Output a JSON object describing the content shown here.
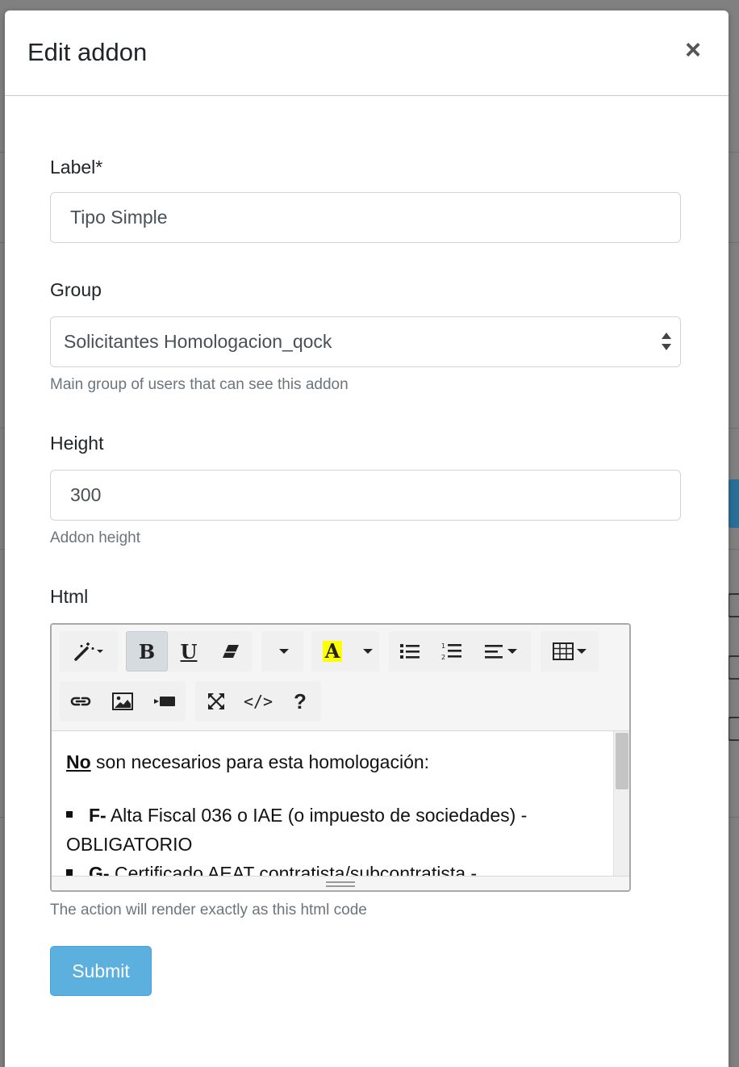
{
  "modal": {
    "title": "Edit addon",
    "close_glyph": "×"
  },
  "form": {
    "label_field": {
      "label": "Label*",
      "value": "Tipo Simple"
    },
    "group_field": {
      "label": "Group",
      "value": "Solicitantes Homologacion_qock",
      "help": "Main group of users that can see this addon"
    },
    "height_field": {
      "label": "Height",
      "value": "300",
      "help": "Addon height"
    },
    "html_field": {
      "label": "Html",
      "help": "The action will render exactly as this html code",
      "content": {
        "intro_bold": "No",
        "intro_rest": " son necesarios para esta homologación:",
        "items": [
          {
            "bold": "F-",
            "text": " Alta Fiscal 036 o IAE (o impuesto de sociedades) - OBLIGATORIO"
          },
          {
            "bold": "G-",
            "text": " Certificado AEAT contratista/subcontratista -"
          }
        ]
      }
    },
    "submit_label": "Submit"
  },
  "toolbar": {
    "bold_label": "B",
    "underline_label": "U",
    "font_color_label": "A",
    "code_label": "</>",
    "help_label": "?"
  },
  "colors": {
    "submit_bg": "#5bb0de",
    "highlight": "#ffff00"
  }
}
